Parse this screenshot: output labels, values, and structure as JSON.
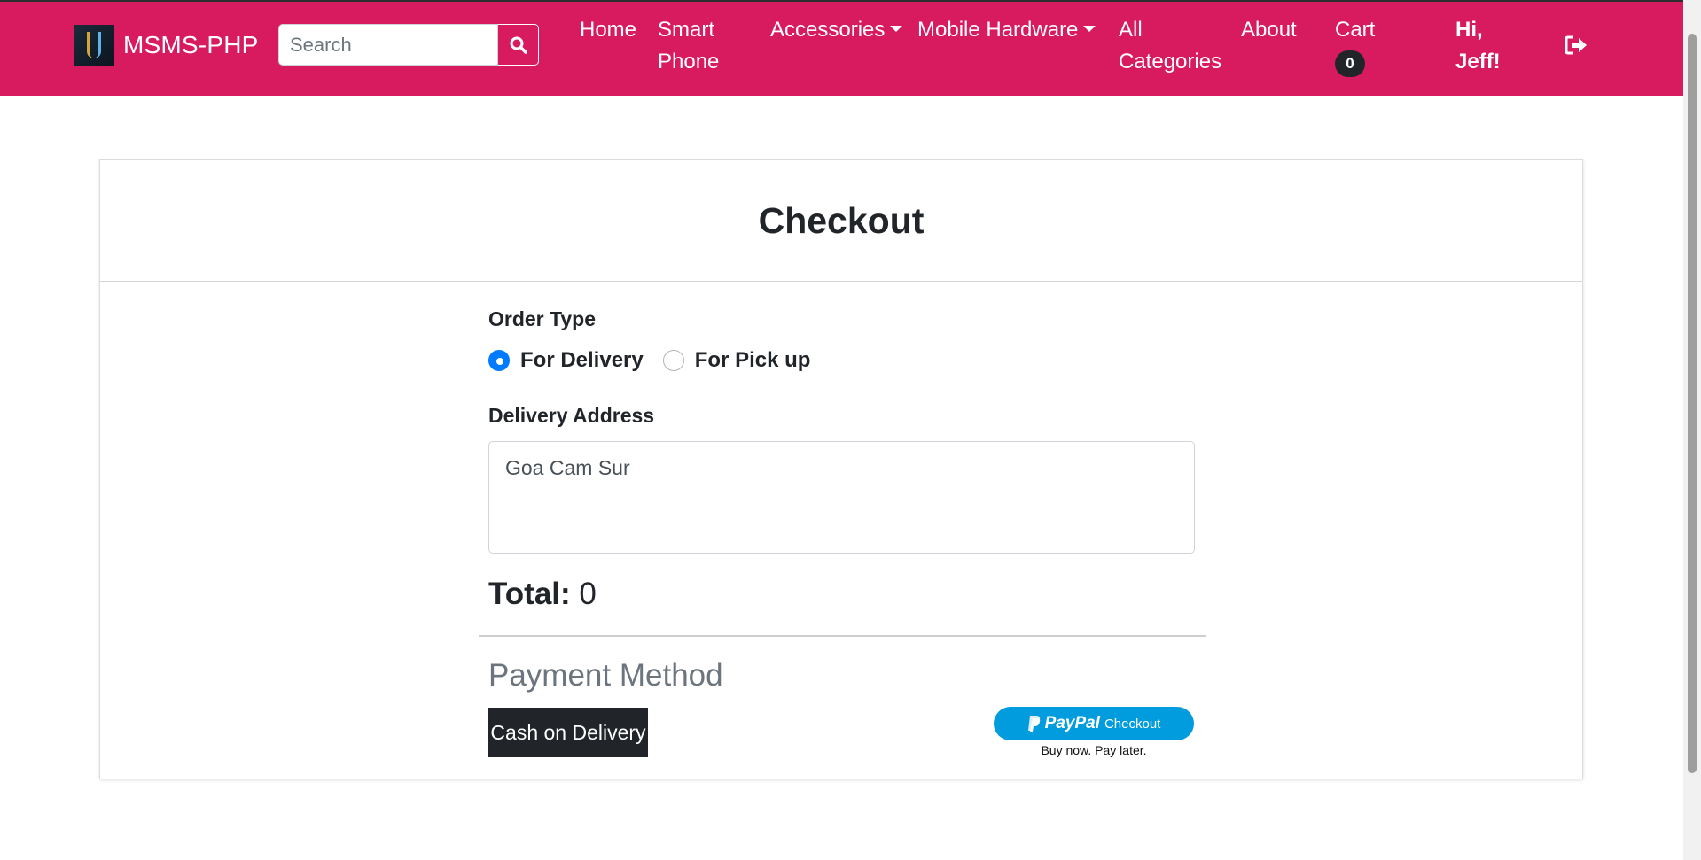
{
  "brand": {
    "name": "MSMS-PHP"
  },
  "search": {
    "placeholder": "Search"
  },
  "nav": {
    "home": "Home",
    "smart_phone_1": "Smart",
    "smart_phone_2": "Phone",
    "accessories": "Accessories",
    "mobile_hardware": "Mobile Hardware",
    "all_categories_1": "All",
    "all_categories_2": "Categories",
    "about": "About",
    "cart": "Cart",
    "cart_count": "0",
    "greeting_1": "Hi,",
    "greeting_2": "Jeff!"
  },
  "checkout": {
    "title": "Checkout",
    "order_type_label": "Order Type",
    "order_types": [
      {
        "label": "For Delivery",
        "checked": true
      },
      {
        "label": "For Pick up",
        "checked": false
      }
    ],
    "address_label": "Delivery Address",
    "address_value": "Goa Cam Sur",
    "total_label": "Total:",
    "total_value": "0",
    "payment_title": "Payment Method",
    "cod_label": "Cash on Delivery",
    "paypal": {
      "logo": "PayPal",
      "label": "Checkout",
      "tagline": "Buy now. Pay later."
    }
  },
  "colors": {
    "navbar": "#d81b5f",
    "primary": "#007bff",
    "paypal": "#009cde",
    "dark": "#212529"
  },
  "icons": {
    "search": "search-icon",
    "logout": "sign-out-icon"
  }
}
